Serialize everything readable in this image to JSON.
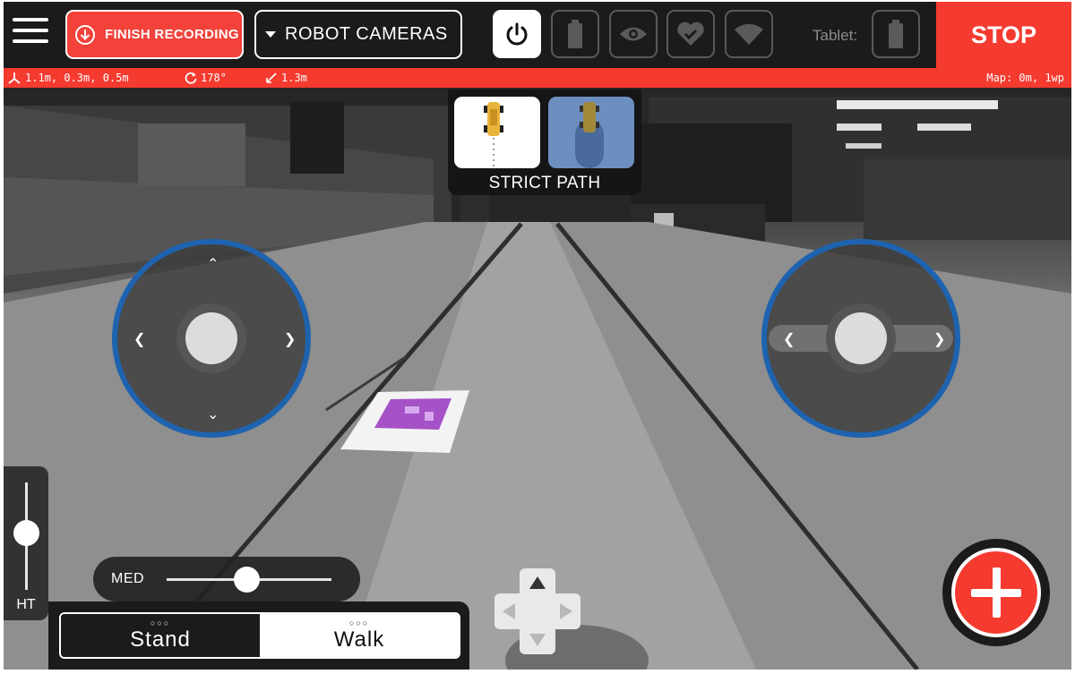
{
  "topbar": {
    "finish_label": "FINISH RECORDING",
    "camera_select": "ROBOT CAMERAS",
    "tablet_label": "Tablet:",
    "stop_label": "STOP"
  },
  "status": {
    "position": "1.1m, 0.3m, 0.5m",
    "rotation": "178°",
    "distance": "1.3m",
    "map": "Map: 0m, 1wp"
  },
  "strict_path": {
    "label": "STRICT PATH"
  },
  "height_slider": {
    "label": "HT"
  },
  "speed_slider": {
    "label": "MED"
  },
  "mode": {
    "stand_label": "Stand",
    "walk_label": "Walk",
    "dots": "○○○"
  },
  "icons": {
    "menu": "hamburger-icon",
    "finish": "download-circle-icon",
    "power": "power-icon",
    "battery": "battery-icon",
    "eye": "eye-icon",
    "health": "heart-check-icon",
    "wifi": "wifi-icon",
    "add": "plus-icon"
  },
  "colors": {
    "accent_red": "#f53a2f",
    "joystick_ring": "#1e63b0",
    "bar_bg": "#1b1b1b"
  }
}
